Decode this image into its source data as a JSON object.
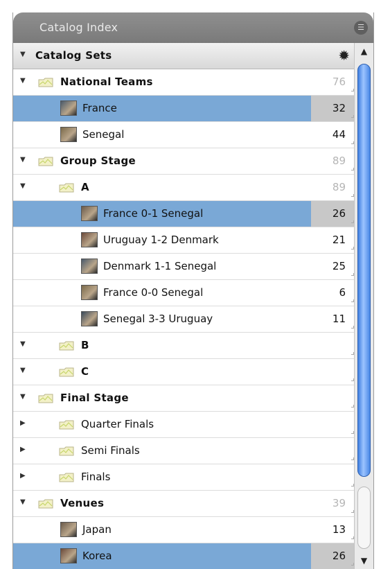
{
  "panel": {
    "title": "Catalog Index",
    "menu_icon": "list-icon"
  },
  "header": {
    "label": "Catalog Sets",
    "gear_icon": "gear-icon"
  },
  "rows": [
    {
      "label": "National Teams",
      "count": "76",
      "bold": true,
      "dim": true,
      "level": 0,
      "triangle": "down",
      "icon": "folder-icon",
      "selected": false
    },
    {
      "label": "France",
      "count": "32",
      "bold": false,
      "dim": false,
      "level": 1,
      "triangle": "",
      "icon": "photo-thumbnail-icon",
      "selected": true
    },
    {
      "label": "Senegal",
      "count": "44",
      "bold": false,
      "dim": false,
      "level": 1,
      "triangle": "",
      "icon": "photo-thumbnail-icon",
      "selected": false
    },
    {
      "label": "Group Stage",
      "count": "89",
      "bold": true,
      "dim": true,
      "level": 0,
      "triangle": "down",
      "icon": "folder-icon",
      "selected": false
    },
    {
      "label": "A",
      "count": "89",
      "bold": true,
      "dim": true,
      "level": 1,
      "triangle": "down",
      "icon": "folder-icon",
      "selected": false
    },
    {
      "label": "France 0-1 Senegal",
      "count": "26",
      "bold": false,
      "dim": false,
      "level": 2,
      "triangle": "",
      "icon": "photo-thumbnail-icon",
      "selected": true
    },
    {
      "label": "Uruguay 1-2 Denmark",
      "count": "21",
      "bold": false,
      "dim": false,
      "level": 2,
      "triangle": "",
      "icon": "photo-thumbnail-icon",
      "selected": false
    },
    {
      "label": "Denmark 1-1 Senegal",
      "count": "25",
      "bold": false,
      "dim": false,
      "level": 2,
      "triangle": "",
      "icon": "photo-thumbnail-icon",
      "selected": false
    },
    {
      "label": "France 0-0 Senegal",
      "count": "6",
      "bold": false,
      "dim": false,
      "level": 2,
      "triangle": "",
      "icon": "photo-thumbnail-icon",
      "selected": false
    },
    {
      "label": "Senegal 3-3 Uruguay",
      "count": "11",
      "bold": false,
      "dim": false,
      "level": 2,
      "triangle": "",
      "icon": "photo-thumbnail-icon",
      "selected": false
    },
    {
      "label": "B",
      "count": "",
      "bold": true,
      "dim": true,
      "level": 1,
      "triangle": "down",
      "icon": "folder-icon",
      "selected": false
    },
    {
      "label": "C",
      "count": "",
      "bold": true,
      "dim": true,
      "level": 1,
      "triangle": "down",
      "icon": "folder-icon",
      "selected": false
    },
    {
      "label": "Final Stage",
      "count": "",
      "bold": true,
      "dim": true,
      "level": 0,
      "triangle": "down",
      "icon": "folder-icon",
      "selected": false
    },
    {
      "label": "Quarter Finals",
      "count": "",
      "bold": false,
      "dim": true,
      "level": 1,
      "triangle": "right",
      "icon": "folder-icon",
      "selected": false
    },
    {
      "label": "Semi Finals",
      "count": "",
      "bold": false,
      "dim": true,
      "level": 1,
      "triangle": "right",
      "icon": "folder-icon",
      "selected": false
    },
    {
      "label": "Finals",
      "count": "",
      "bold": false,
      "dim": true,
      "level": 1,
      "triangle": "right",
      "icon": "folder-icon",
      "selected": false
    },
    {
      "label": "Venues",
      "count": "39",
      "bold": true,
      "dim": true,
      "level": 0,
      "triangle": "down",
      "icon": "folder-icon",
      "selected": false
    },
    {
      "label": "Japan",
      "count": "13",
      "bold": false,
      "dim": false,
      "level": 1,
      "triangle": "",
      "icon": "photo-thumbnail-icon",
      "selected": false
    },
    {
      "label": "Korea",
      "count": "26",
      "bold": false,
      "dim": false,
      "level": 1,
      "triangle": "",
      "icon": "photo-thumbnail-icon",
      "selected": true
    }
  ],
  "colors": {
    "selection": "#7aa8d6",
    "scroll_thumb": "#4a88e6"
  },
  "scrollbar": {
    "up_icon": "scroll-up-arrow-icon",
    "down_icon": "scroll-down-arrow-icon"
  }
}
